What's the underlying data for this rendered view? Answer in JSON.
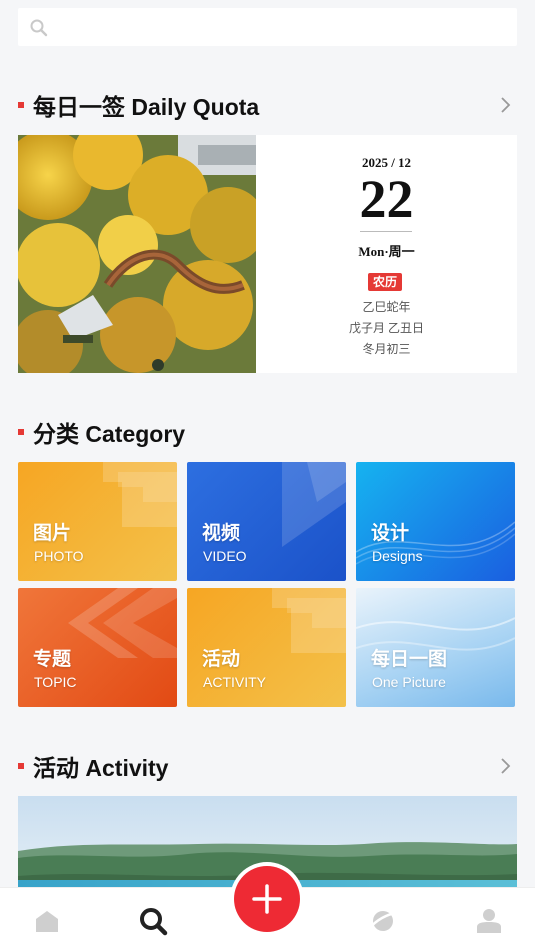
{
  "search": {
    "placeholder": ""
  },
  "daily_quota": {
    "title": "每日一签 Daily Quota",
    "year_month": "2025 / 12",
    "day": "22",
    "weekday": "Mon·周一",
    "lunar_badge": "农历",
    "lunar_year": "乙巳蛇年",
    "lunar_month_day": "戊子月 乙丑日",
    "lunar_date": "冬月初三"
  },
  "category": {
    "title": "分类 Category",
    "tiles": [
      {
        "zh": "图片",
        "en": "PHOTO"
      },
      {
        "zh": "视频",
        "en": "VIDEO"
      },
      {
        "zh": "设计",
        "en": "Designs"
      },
      {
        "zh": "专题",
        "en": "TOPIC"
      },
      {
        "zh": "活动",
        "en": "ACTIVITY"
      },
      {
        "zh": "每日一图",
        "en": "One Picture"
      }
    ]
  },
  "activity": {
    "title": "活动 Activity"
  },
  "tabbar": {
    "items": [
      {
        "icon": "home-icon"
      },
      {
        "icon": "discover-icon"
      },
      {
        "icon": "add-icon"
      },
      {
        "icon": "planet-icon"
      },
      {
        "icon": "profile-icon"
      }
    ]
  },
  "colors": {
    "accent": "#e53935",
    "fab": "#ee2a34",
    "tab_active": "#222222",
    "tab_inactive": "#cfcfcf"
  }
}
